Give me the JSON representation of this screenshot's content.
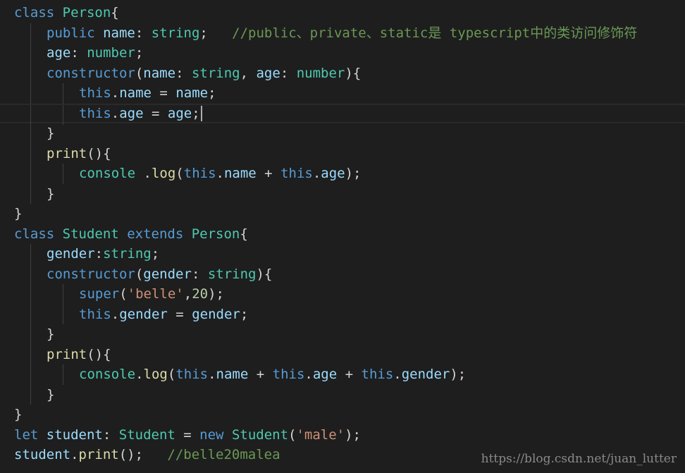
{
  "editor": {
    "colors": {
      "background": "#1e1e1e",
      "keyword": "#569cd6",
      "type": "#4ec9b0",
      "variable": "#9cdcfe",
      "function": "#dcdcaa",
      "string": "#ce9178",
      "number": "#b5cea8",
      "comment": "#6a9955",
      "punctuation": "#d4d4d4"
    },
    "cursor_line": 6,
    "lines": [
      {
        "indent": 0,
        "tokens": [
          {
            "t": "class",
            "c": "kw"
          },
          {
            "t": " ",
            "c": "punc"
          },
          {
            "t": "Person",
            "c": "ty"
          },
          {
            "t": "{",
            "c": "punc"
          }
        ]
      },
      {
        "indent": 1,
        "tokens": [
          {
            "t": "public",
            "c": "kw"
          },
          {
            "t": " ",
            "c": "punc"
          },
          {
            "t": "name",
            "c": "var"
          },
          {
            "t": ": ",
            "c": "punc"
          },
          {
            "t": "string",
            "c": "ty"
          },
          {
            "t": ";   ",
            "c": "punc"
          },
          {
            "t": "//public、private、static是 typescript中的类访问修饰符",
            "c": "cmt"
          }
        ]
      },
      {
        "indent": 1,
        "tokens": [
          {
            "t": "age",
            "c": "var"
          },
          {
            "t": ": ",
            "c": "punc"
          },
          {
            "t": "number",
            "c": "ty"
          },
          {
            "t": ";",
            "c": "punc"
          }
        ]
      },
      {
        "indent": 1,
        "tokens": [
          {
            "t": "constructor",
            "c": "kw"
          },
          {
            "t": "(",
            "c": "punc"
          },
          {
            "t": "name",
            "c": "var"
          },
          {
            "t": ": ",
            "c": "punc"
          },
          {
            "t": "string",
            "c": "ty"
          },
          {
            "t": ", ",
            "c": "punc"
          },
          {
            "t": "age",
            "c": "var"
          },
          {
            "t": ": ",
            "c": "punc"
          },
          {
            "t": "number",
            "c": "ty"
          },
          {
            "t": "){",
            "c": "punc"
          }
        ]
      },
      {
        "indent": 2,
        "tokens": [
          {
            "t": "this",
            "c": "kw"
          },
          {
            "t": ".",
            "c": "punc"
          },
          {
            "t": "name",
            "c": "var"
          },
          {
            "t": " = ",
            "c": "punc"
          },
          {
            "t": "name",
            "c": "var"
          },
          {
            "t": ";",
            "c": "punc"
          }
        ]
      },
      {
        "indent": 2,
        "tokens": [
          {
            "t": "this",
            "c": "kw"
          },
          {
            "t": ".",
            "c": "punc"
          },
          {
            "t": "age",
            "c": "var"
          },
          {
            "t": " = ",
            "c": "punc"
          },
          {
            "t": "age",
            "c": "var"
          },
          {
            "t": ";",
            "c": "punc"
          }
        ]
      },
      {
        "indent": 1,
        "tokens": [
          {
            "t": "}",
            "c": "punc"
          }
        ]
      },
      {
        "indent": 1,
        "tokens": [
          {
            "t": "print",
            "c": "fn"
          },
          {
            "t": "(){",
            "c": "punc"
          }
        ]
      },
      {
        "indent": 2,
        "tokens": [
          {
            "t": "console",
            "c": "ty"
          },
          {
            "t": " .",
            "c": "punc"
          },
          {
            "t": "log",
            "c": "fn"
          },
          {
            "t": "(",
            "c": "punc"
          },
          {
            "t": "this",
            "c": "kw"
          },
          {
            "t": ".",
            "c": "punc"
          },
          {
            "t": "name",
            "c": "var"
          },
          {
            "t": " + ",
            "c": "punc"
          },
          {
            "t": "this",
            "c": "kw"
          },
          {
            "t": ".",
            "c": "punc"
          },
          {
            "t": "age",
            "c": "var"
          },
          {
            "t": ");",
            "c": "punc"
          }
        ]
      },
      {
        "indent": 1,
        "tokens": [
          {
            "t": "}",
            "c": "punc"
          }
        ]
      },
      {
        "indent": 0,
        "tokens": [
          {
            "t": "}",
            "c": "punc"
          }
        ]
      },
      {
        "indent": 0,
        "tokens": [
          {
            "t": "class",
            "c": "kw"
          },
          {
            "t": " ",
            "c": "punc"
          },
          {
            "t": "Student",
            "c": "ty"
          },
          {
            "t": " ",
            "c": "punc"
          },
          {
            "t": "extends",
            "c": "kw"
          },
          {
            "t": " ",
            "c": "punc"
          },
          {
            "t": "Person",
            "c": "ty"
          },
          {
            "t": "{",
            "c": "punc"
          }
        ]
      },
      {
        "indent": 1,
        "tokens": [
          {
            "t": "gender",
            "c": "var"
          },
          {
            "t": ":",
            "c": "punc"
          },
          {
            "t": "string",
            "c": "ty"
          },
          {
            "t": ";",
            "c": "punc"
          }
        ]
      },
      {
        "indent": 1,
        "tokens": [
          {
            "t": "constructor",
            "c": "kw"
          },
          {
            "t": "(",
            "c": "punc"
          },
          {
            "t": "gender",
            "c": "var"
          },
          {
            "t": ": ",
            "c": "punc"
          },
          {
            "t": "string",
            "c": "ty"
          },
          {
            "t": "){",
            "c": "punc"
          }
        ]
      },
      {
        "indent": 2,
        "tokens": [
          {
            "t": "super",
            "c": "kw"
          },
          {
            "t": "(",
            "c": "punc"
          },
          {
            "t": "'belle'",
            "c": "str"
          },
          {
            "t": ",",
            "c": "punc"
          },
          {
            "t": "20",
            "c": "num"
          },
          {
            "t": ");",
            "c": "punc"
          }
        ]
      },
      {
        "indent": 2,
        "tokens": [
          {
            "t": "this",
            "c": "kw"
          },
          {
            "t": ".",
            "c": "punc"
          },
          {
            "t": "gender",
            "c": "var"
          },
          {
            "t": " = ",
            "c": "punc"
          },
          {
            "t": "gender",
            "c": "var"
          },
          {
            "t": ";",
            "c": "punc"
          }
        ]
      },
      {
        "indent": 1,
        "tokens": [
          {
            "t": "}",
            "c": "punc"
          }
        ]
      },
      {
        "indent": 1,
        "tokens": [
          {
            "t": "print",
            "c": "fn"
          },
          {
            "t": "(){",
            "c": "punc"
          }
        ]
      },
      {
        "indent": 2,
        "tokens": [
          {
            "t": "console",
            "c": "ty"
          },
          {
            "t": ".",
            "c": "punc"
          },
          {
            "t": "log",
            "c": "fn"
          },
          {
            "t": "(",
            "c": "punc"
          },
          {
            "t": "this",
            "c": "kw"
          },
          {
            "t": ".",
            "c": "punc"
          },
          {
            "t": "name",
            "c": "var"
          },
          {
            "t": " + ",
            "c": "punc"
          },
          {
            "t": "this",
            "c": "kw"
          },
          {
            "t": ".",
            "c": "punc"
          },
          {
            "t": "age",
            "c": "var"
          },
          {
            "t": " + ",
            "c": "punc"
          },
          {
            "t": "this",
            "c": "kw"
          },
          {
            "t": ".",
            "c": "punc"
          },
          {
            "t": "gender",
            "c": "var"
          },
          {
            "t": ");",
            "c": "punc"
          }
        ]
      },
      {
        "indent": 1,
        "tokens": [
          {
            "t": "}",
            "c": "punc"
          }
        ]
      },
      {
        "indent": 0,
        "tokens": [
          {
            "t": "}",
            "c": "punc"
          }
        ]
      },
      {
        "indent": 0,
        "tokens": [
          {
            "t": "let",
            "c": "kw"
          },
          {
            "t": " ",
            "c": "punc"
          },
          {
            "t": "student",
            "c": "var"
          },
          {
            "t": ": ",
            "c": "punc"
          },
          {
            "t": "Student",
            "c": "ty"
          },
          {
            "t": " = ",
            "c": "punc"
          },
          {
            "t": "new",
            "c": "kw"
          },
          {
            "t": " ",
            "c": "punc"
          },
          {
            "t": "Student",
            "c": "ty"
          },
          {
            "t": "(",
            "c": "punc"
          },
          {
            "t": "'male'",
            "c": "str"
          },
          {
            "t": ");",
            "c": "punc"
          }
        ]
      },
      {
        "indent": 0,
        "tokens": [
          {
            "t": "student",
            "c": "var"
          },
          {
            "t": ".",
            "c": "punc"
          },
          {
            "t": "print",
            "c": "fn"
          },
          {
            "t": "();   ",
            "c": "punc"
          },
          {
            "t": "//belle20malea",
            "c": "cmt"
          }
        ]
      }
    ]
  },
  "watermark": {
    "text": "https://blog.csdn.net/juan_lutter"
  }
}
